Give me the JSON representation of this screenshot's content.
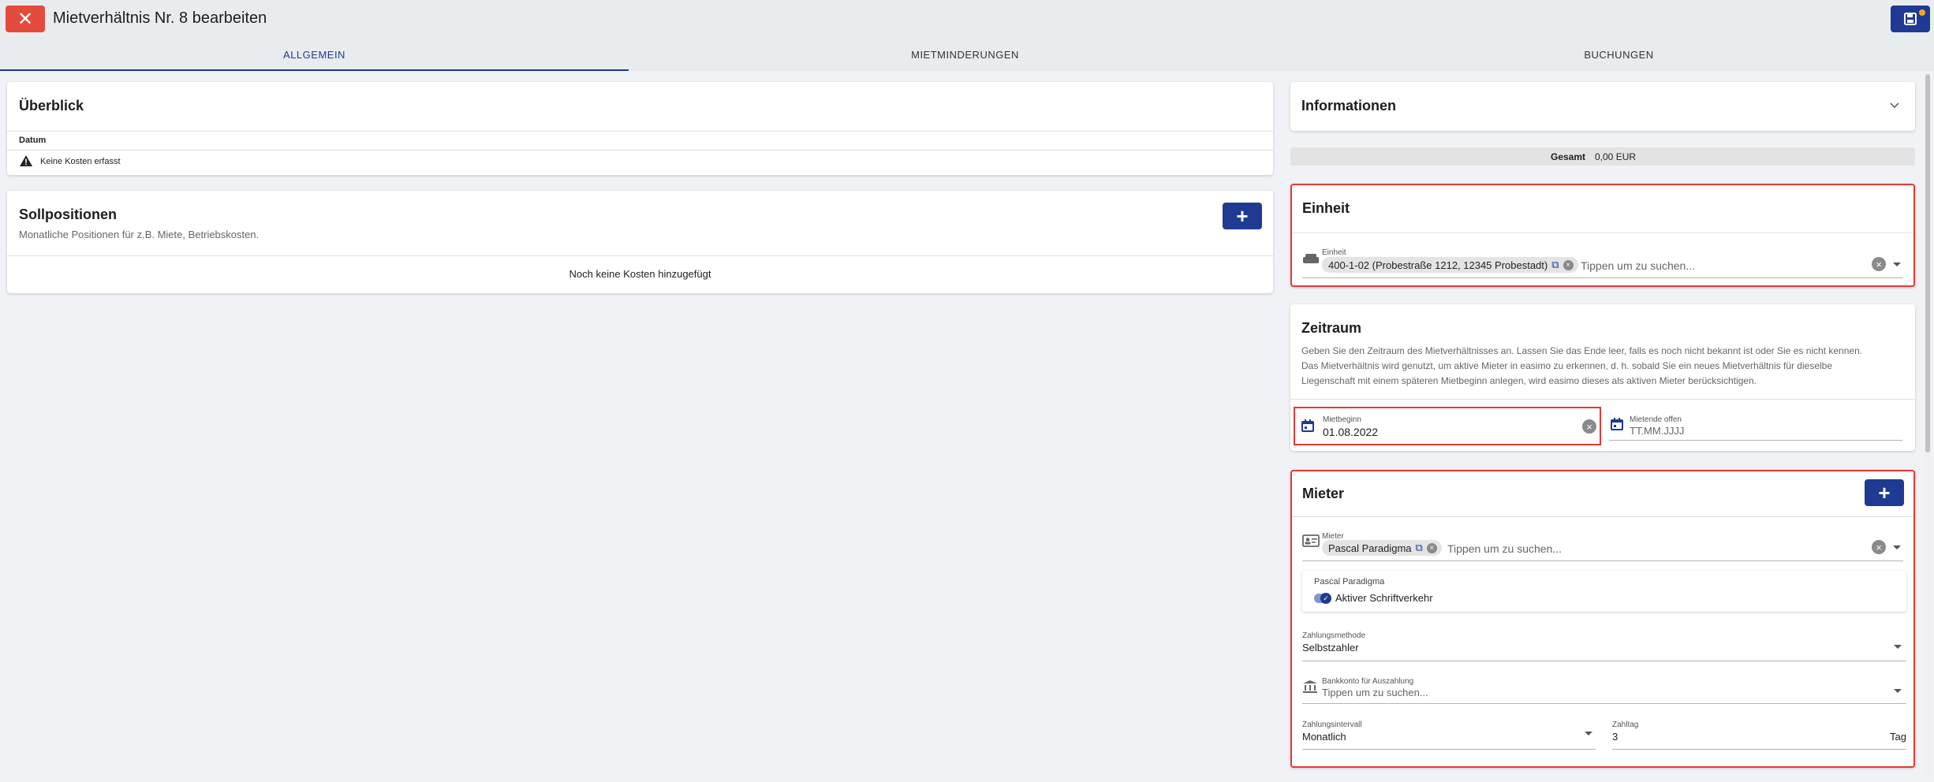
{
  "header": {
    "title": "Mietverhältnis Nr. 8 bearbeiten"
  },
  "tabs": [
    "ALLGEMEIN",
    "MIETMINDERUNGEN",
    "BUCHUNGEN"
  ],
  "overview": {
    "title": "Überblick",
    "column_header": "Datum",
    "warning_text": "Keine Kosten erfasst"
  },
  "targets": {
    "title": "Sollpositionen",
    "subtitle": "Monatliche Positionen für z.B. Miete, Betriebskosten.",
    "empty_text": "Noch keine Kosten hinzugefügt"
  },
  "info": {
    "title": "Informationen",
    "total_label": "Gesamt",
    "total_value": "0,00 EUR"
  },
  "unit": {
    "title": "Einheit",
    "field_label": "Einheit",
    "chip_text": "400-1-02 (Probestraße 1212, 12345 Probestadt)",
    "placeholder": "Tippen um zu suchen..."
  },
  "period": {
    "title": "Zeitraum",
    "description_1": "Geben Sie den Zeitraum des Mietverhältnisses an. Lassen Sie das Ende leer, falls es noch nicht bekannt ist oder Sie es nicht kennen.",
    "description_2": "Das Mietverhältnis wird genutzt, um aktive Mieter in easimo zu erkennen, d. h. sobald Sie ein neues Mietverhältnis für dieselbe",
    "description_3": "Liegenschaft mit einem späteren Mietbeginn anlegen, wird easimo dieses als aktiven Mieter berücksichtigen.",
    "start_label": "Mietbeginn",
    "start_value": "01.08.2022",
    "end_label": "Mietende offen",
    "end_placeholder": "TT.MM.JJJJ"
  },
  "tenant": {
    "title": "Mieter",
    "field_label": "Mieter",
    "chip_text": "Pascal Paradigma",
    "placeholder": "Tippen um zu suchen...",
    "sub_name": "Pascal Paradigma",
    "toggle_label": "Aktiver Schriftverkehr",
    "toggle_on": true,
    "payment_method_label": "Zahlungsmethode",
    "payment_method_value": "Selbstzahler",
    "bank_label": "Bankkonto für Auszahlung",
    "bank_placeholder": "Tippen um zu suchen...",
    "interval_label": "Zahlungsintervall",
    "interval_value": "Monatlich",
    "payday_label": "Zahltag",
    "payday_value": "3",
    "payday_suffix": "Tag"
  },
  "colors": {
    "accent": "#1f3a93",
    "danger": "#e54b3c",
    "highlight_border": "#e53935",
    "background": "#f0f2f5"
  },
  "icons": [
    "close-icon",
    "save-icon",
    "warning-icon",
    "plus-icon",
    "chevron-down-icon",
    "sofa-icon",
    "external-link-icon",
    "clear-icon",
    "calendar-icon",
    "id-card-icon",
    "bank-icon"
  ]
}
